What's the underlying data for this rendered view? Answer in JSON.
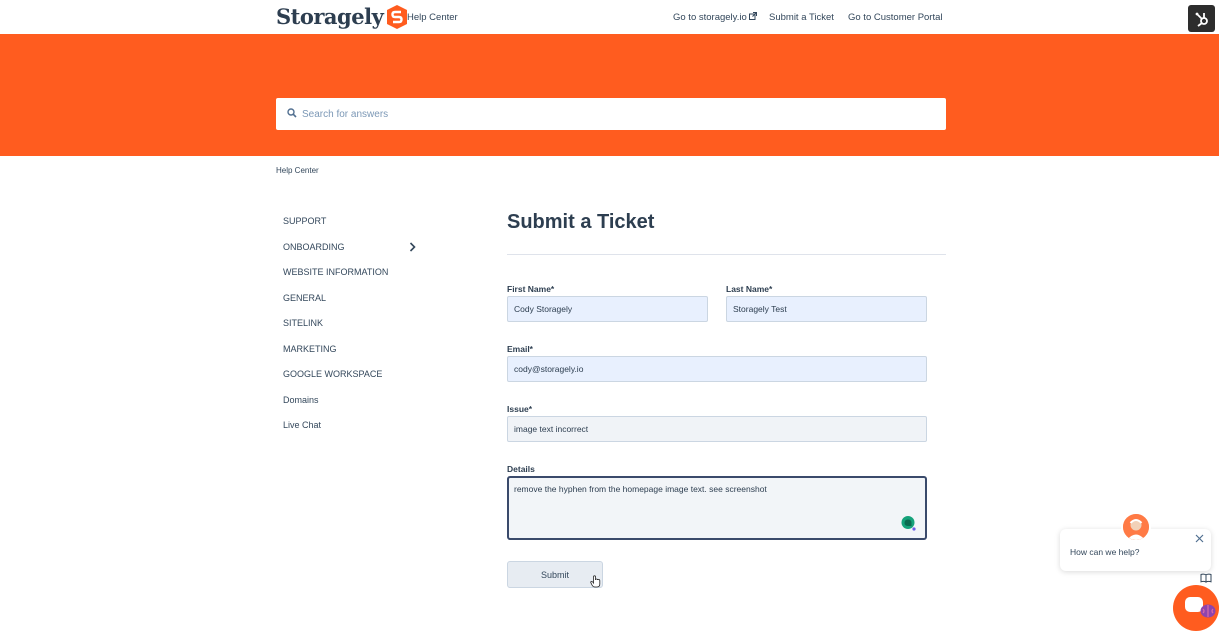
{
  "header": {
    "logo_text": "Storagely",
    "help_center": "Help Center",
    "nav": [
      {
        "label": "Go to storagely.io"
      },
      {
        "label": "Submit a Ticket"
      },
      {
        "label": "Go to Customer Portal"
      }
    ]
  },
  "search": {
    "placeholder": "Search for answers"
  },
  "breadcrumb": "Help Center",
  "sidebar": {
    "items": [
      {
        "label": "SUPPORT"
      },
      {
        "label": "ONBOARDING"
      },
      {
        "label": "WEBSITE INFORMATION"
      },
      {
        "label": "GENERAL"
      },
      {
        "label": "SITELINK"
      },
      {
        "label": "MARKETING"
      },
      {
        "label": "GOOGLE WORKSPACE"
      },
      {
        "label": "Domains"
      },
      {
        "label": "Live Chat"
      }
    ]
  },
  "form": {
    "title": "Submit a Ticket",
    "first_name_label": "First Name*",
    "first_name_value": "Cody Storagely",
    "last_name_label": "Last Name*",
    "last_name_value": "Storagely Test",
    "email_label": "Email*",
    "email_value": "cody@storagely.io",
    "issue_label": "Issue*",
    "issue_value": "image text incorrect",
    "details_label": "Details",
    "details_value": "remove the hyphen from the homepage image text. see screenshot",
    "submit_label": "Submit"
  },
  "chat": {
    "prompt": "How can we help?"
  },
  "colors": {
    "brand": "#ff5c1f",
    "text": "#33475b",
    "field_fill": "#e8f0fe"
  }
}
